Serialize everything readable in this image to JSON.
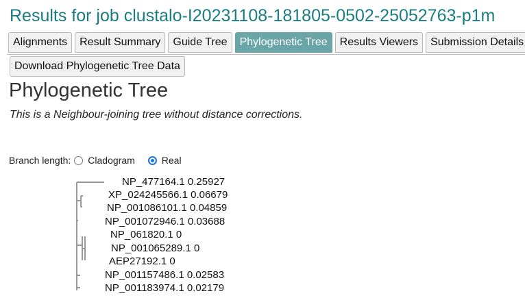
{
  "header": {
    "title": "Results for job clustalo-I20231108-181805-0502-25052763-p1m"
  },
  "tabs": [
    {
      "label": "Alignments",
      "active": false
    },
    {
      "label": "Result Summary",
      "active": false
    },
    {
      "label": "Guide Tree",
      "active": false
    },
    {
      "label": "Phylogenetic Tree",
      "active": true
    },
    {
      "label": "Results Viewers",
      "active": false
    },
    {
      "label": "Submission Details",
      "active": false
    }
  ],
  "download_button": {
    "label": "Download Phylogenetic Tree Data"
  },
  "page": {
    "heading": "Phylogenetic Tree",
    "subtitle": "This is a Neighbour-joining tree without distance corrections."
  },
  "branch_length": {
    "label": "Branch length:",
    "options": [
      {
        "label": "Cladogram",
        "selected": false
      },
      {
        "label": "Real",
        "selected": true
      }
    ]
  },
  "tree": {
    "leaves": [
      "NP_477164.1 0.25927",
      "XP_024245566.1 0.06679",
      "NP_001086101.1 0.04859",
      "NP_001072946.1 0.03688",
      "NP_061820.1 0",
      "NP_001065289.1 0",
      "AEP27192.1 0",
      "NP_001157486.1 0.02583",
      "NP_001183974.1 0.02179"
    ]
  },
  "colors": {
    "title": "#1a7d82",
    "active_tab": "#6aa6a8",
    "radio_selected": "#1a73e8",
    "tree_lines": "#999999"
  }
}
